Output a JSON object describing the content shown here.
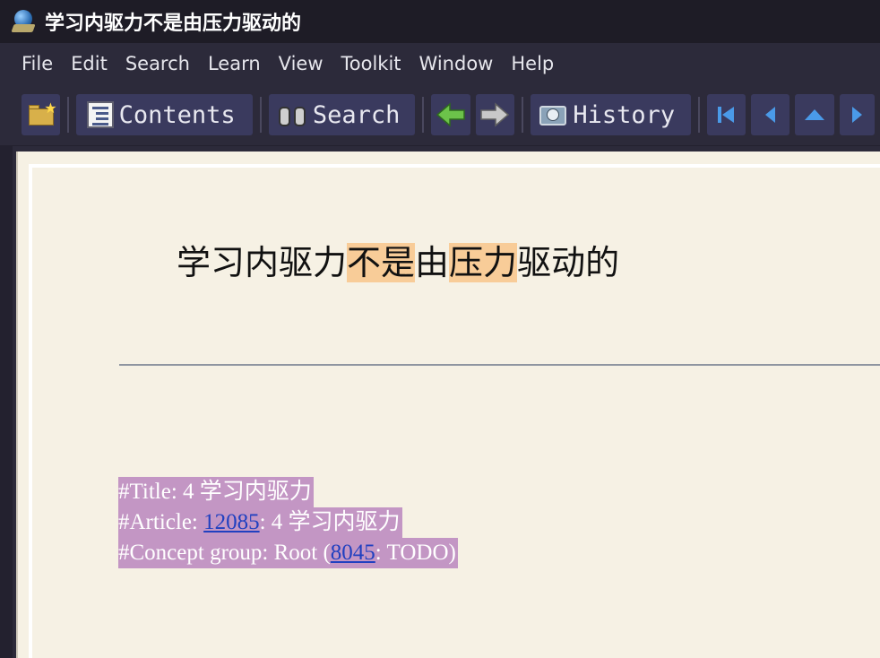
{
  "window": {
    "title": "学习内驱力不是由压力驱动的"
  },
  "menu": [
    "File",
    "Edit",
    "Search",
    "Learn",
    "View",
    "Toolkit",
    "Window",
    "Help"
  ],
  "toolbar": {
    "contents_label": "Contents",
    "search_label": "Search",
    "history_label": "History"
  },
  "article": {
    "heading_parts": [
      "学习内驱力",
      "不是",
      "由",
      "压力",
      "驱动的"
    ],
    "meta": {
      "title_line": "#Title: 4 学习内驱力",
      "article_prefix": "#Article: ",
      "article_id": "12085",
      "article_suffix": ": 4 学习内驱力",
      "concept_prefix": "#Concept group: Root (",
      "concept_id": "8045",
      "concept_suffix": ": TODO)"
    }
  },
  "colors": {
    "highlight": "#f8cc98",
    "meta_background": "#c396c4",
    "page_background": "#f6f1e4",
    "toolbar_button": "#3a3a5e"
  }
}
